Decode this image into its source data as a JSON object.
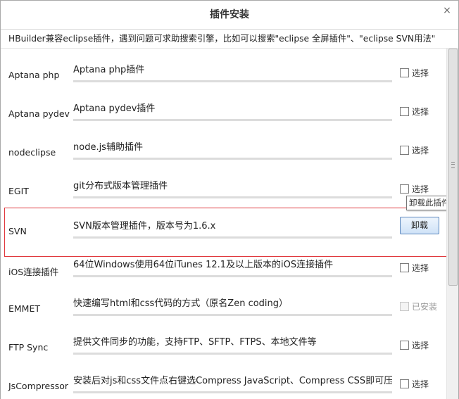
{
  "dialog": {
    "title": "插件安装",
    "close_glyph": "×",
    "hint": "HBuilder兼容eclipse插件，遇到问题可求助搜索引擎，比如可以搜索\"eclipse 全屏插件\"、\"eclipse SVN用法\""
  },
  "plugins": [
    {
      "name": "Aptana php",
      "desc": "Aptana php插件",
      "action": "选择"
    },
    {
      "name": "Aptana pydev",
      "desc": "Aptana pydev插件",
      "action": "选择"
    },
    {
      "name": "nodeclipse",
      "desc": "node.js辅助插件",
      "action": "选择"
    },
    {
      "name": "EGIT",
      "desc": "git分布式版本管理插件",
      "action": "选择"
    },
    {
      "name": "SVN",
      "desc": "SVN版本管理插件，版本号为1.6.x",
      "action": "卸载"
    },
    {
      "name": "iOS连接插件",
      "desc": "64位Windows使用64位iTunes 12.1及以上版本的iOS连接插件",
      "action": "选择"
    },
    {
      "name": "EMMET",
      "desc": "快速编写html和css代码的方式（原名Zen coding）",
      "action": "已安装"
    },
    {
      "name": "FTP Sync",
      "desc": "提供文件同步的功能，支持FTP、SFTP、FTPS、本地文件等",
      "action": "选择"
    },
    {
      "name": "JsCompressor",
      "desc": "安装后对js和css文件点右键选Compress JavaScript、Compress CSS即可压缩",
      "action": "选择"
    }
  ],
  "tooltip": "卸载此插件",
  "colors": {
    "highlight_border": "#e0393e",
    "button_border": "#5b87bd"
  }
}
